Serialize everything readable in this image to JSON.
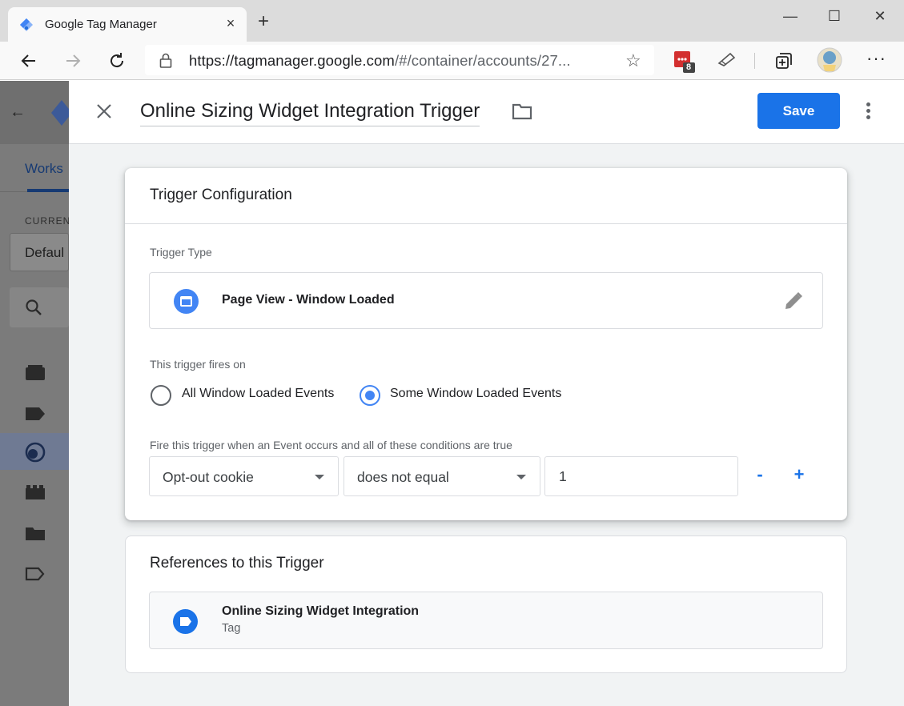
{
  "browser": {
    "tab_title": "Google Tag Manager",
    "tab_close": "×",
    "new_tab": "+",
    "window_controls": {
      "minimize": "—",
      "maximize": "☐",
      "close": "✕"
    },
    "url_host": "https://tagmanager.google.com",
    "url_path": "/#/container/accounts/27...",
    "extension_badge": "8",
    "more": "···"
  },
  "background_app": {
    "tab_label": "Works",
    "section_label": "CURREN",
    "workspace": "Defaul",
    "nav_icons": [
      "overview-icon",
      "tags-icon",
      "triggers-icon",
      "variables-icon",
      "folders-icon",
      "templates-icon"
    ]
  },
  "panel": {
    "close": "×",
    "trigger_name": "Online Sizing Widget Integration Trigger",
    "save_label": "Save"
  },
  "config": {
    "title": "Trigger Configuration",
    "trigger_type_label": "Trigger Type",
    "trigger_type_value": "Page View - Window Loaded",
    "fires_on_label": "This trigger fires on",
    "options": [
      {
        "label": "All Window Loaded Events",
        "selected": false
      },
      {
        "label": "Some Window Loaded Events",
        "selected": true
      }
    ],
    "condition_label": "Fire this trigger when an Event occurs and all of these conditions are true",
    "condition": {
      "variable": "Opt-out cookie",
      "operator": "does not equal",
      "value": "1"
    },
    "remove_label": "-",
    "add_label": "+"
  },
  "references": {
    "title": "References to this Trigger",
    "items": [
      {
        "name": "Online Sizing Widget Integration",
        "type": "Tag"
      }
    ]
  },
  "colors": {
    "accent": "#1a73e8",
    "icon_blue": "#4285f4",
    "panel_bg": "#f1f3f4",
    "overlay": "#7b7b7b"
  }
}
